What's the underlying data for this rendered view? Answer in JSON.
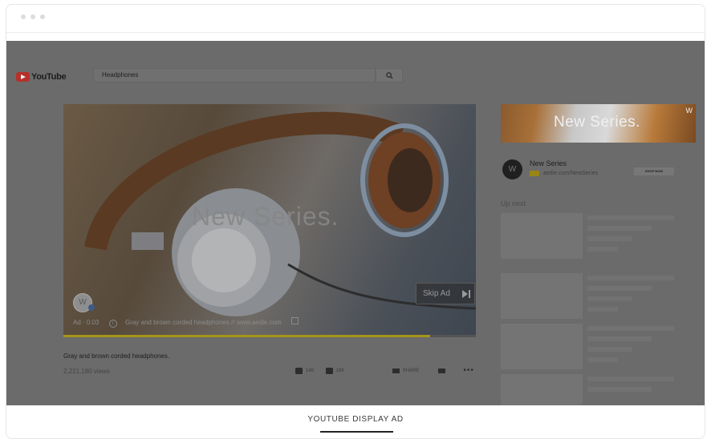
{
  "youtube": {
    "logo_text": "YouTube",
    "search_value": "Headphones"
  },
  "player": {
    "overlay_title": "New Series.",
    "skip_label": "Skip Ad",
    "ad_time": "Ad · 0:03",
    "ad_description": "Gray and brown corded headphones // www.aedie.com",
    "brand_logo_letter": "W",
    "progress": 0.89
  },
  "video": {
    "description": "Gray and brown corded headphones.",
    "views": "2,221,180 views",
    "likes": "14K",
    "dislikes": "189",
    "share_label": "SHARE"
  },
  "sidebar": {
    "banner_title": "New Series.",
    "banner_logo_letter": "W",
    "channel_letter": "W",
    "channel_title": "New Series",
    "channel_url": "aedie.com/NewSeries",
    "shop_label": "SHOP NOW",
    "up_next_label": "Up next"
  },
  "caption": "YOUTUBE DISPLAY AD",
  "colors": {
    "overlay": "#6b6b6b",
    "youtube_red": "#b5302b",
    "progress": "#a59419"
  }
}
